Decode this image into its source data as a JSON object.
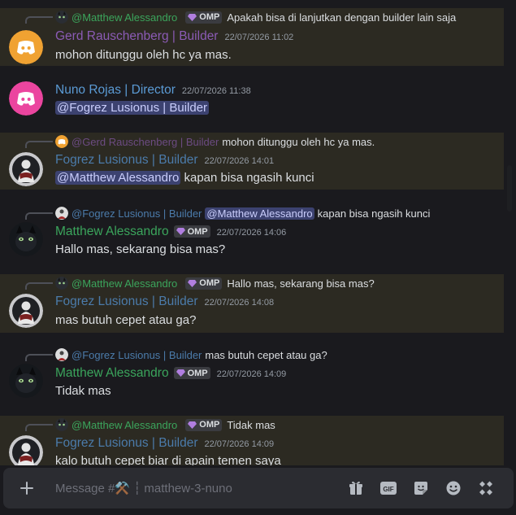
{
  "messages": [
    {
      "reply": {
        "name": "@Matthew Alessandro",
        "tag": "OMP",
        "text": "Apakah bisa di lanjutkan dengan builder lain saja"
      },
      "author": "Gerd Rauschenberg | Builder",
      "timestamp": "22/07/2026 11:02",
      "text": "mohon ditunggu oleh hc ya mas."
    },
    {
      "author": "Nuno Rojas | Director",
      "timestamp": "22/07/2026 11:38",
      "mention": "@Fogrez Lusionus | Builder"
    },
    {
      "reply": {
        "name": "@Gerd Rauschenberg | Builder",
        "text": "mohon ditunggu oleh hc ya mas."
      },
      "author": "Fogrez Lusionus | Builder",
      "timestamp": "22/07/2026 14:01",
      "mention": "@Matthew Alessandro",
      "text": "kapan bisa ngasih kunci"
    },
    {
      "reply": {
        "name": "@Fogrez Lusionus | Builder",
        "mention": "@Matthew Alessandro",
        "text": "kapan bisa ngasih kunci"
      },
      "author": "Matthew Alessandro",
      "tag": "OMP",
      "timestamp": "22/07/2026 14:06",
      "text": "Hallo mas, sekarang bisa mas?"
    },
    {
      "reply": {
        "name": "@Matthew Alessandro",
        "tag": "OMP",
        "text": "Hallo mas, sekarang bisa mas?"
      },
      "author": "Fogrez Lusionus | Builder",
      "timestamp": "22/07/2026 14:08",
      "text": "mas butuh cepet atau ga?"
    },
    {
      "reply": {
        "name": "@Fogrez Lusionus | Builder",
        "text": "mas butuh cepet atau ga?"
      },
      "author": "Matthew Alessandro",
      "tag": "OMP",
      "timestamp": "22/07/2026 14:09",
      "text": "Tidak mas"
    },
    {
      "reply": {
        "name": "@Matthew Alessandro",
        "tag": "OMP",
        "text": "Tidak mas"
      },
      "author": "Fogrez Lusionus | Builder",
      "timestamp": "22/07/2026 14:09",
      "text": "kalo butuh cepet biar di apain temen saya"
    }
  ],
  "composer": {
    "placeholder": "Message #⚒️ ┆ matthew-3-nuno"
  },
  "icons": [
    "plus-icon",
    "gift-icon",
    "gif-icon",
    "sticker-icon",
    "emoji-icon",
    "apps-icon"
  ],
  "colors": {
    "background": "#1a1a1e",
    "highlight": "#2c2a22",
    "mention_bg": "#3c4270",
    "discord": "#5865f2"
  }
}
